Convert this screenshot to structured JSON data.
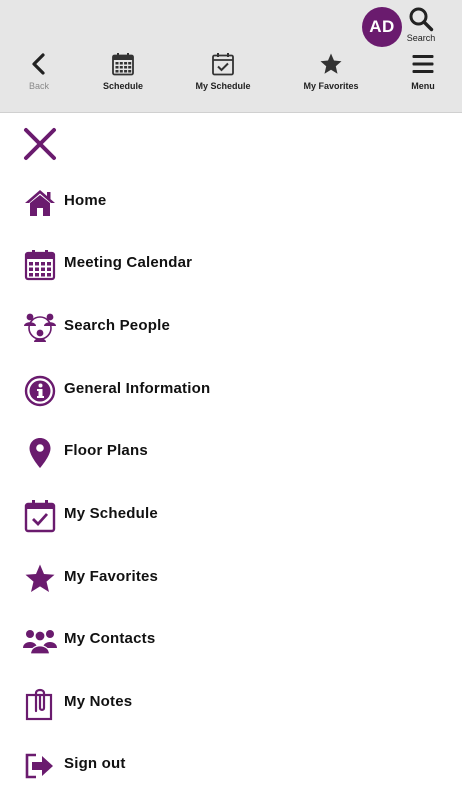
{
  "colors": {
    "accent": "#6a1b6e",
    "header_bg": "#e6e6e6",
    "icon_dark": "#333333"
  },
  "header": {
    "avatar_initials": "AD",
    "search_label": "Search",
    "nav": [
      {
        "label": "Back",
        "icon": "chevron-left-icon"
      },
      {
        "label": "Schedule",
        "icon": "calendar-icon"
      },
      {
        "label": "My Schedule",
        "icon": "calendar-check-icon"
      },
      {
        "label": "My Favorites",
        "icon": "star-icon"
      },
      {
        "label": "Menu",
        "icon": "hamburger-icon"
      }
    ]
  },
  "menu": {
    "close_icon": "close-icon",
    "items": [
      {
        "label": "Home",
        "icon": "home-icon"
      },
      {
        "label": "Meeting Calendar",
        "icon": "calendar-icon"
      },
      {
        "label": "Search People",
        "icon": "people-network-icon"
      },
      {
        "label": "General Information",
        "icon": "info-icon"
      },
      {
        "label": "Floor Plans",
        "icon": "map-pin-icon"
      },
      {
        "label": "My Schedule",
        "icon": "calendar-check-icon"
      },
      {
        "label": "My Favorites",
        "icon": "star-icon"
      },
      {
        "label": "My Contacts",
        "icon": "contacts-icon"
      },
      {
        "label": "My Notes",
        "icon": "clipboard-icon"
      },
      {
        "label": "Sign out",
        "icon": "sign-out-icon"
      }
    ]
  }
}
